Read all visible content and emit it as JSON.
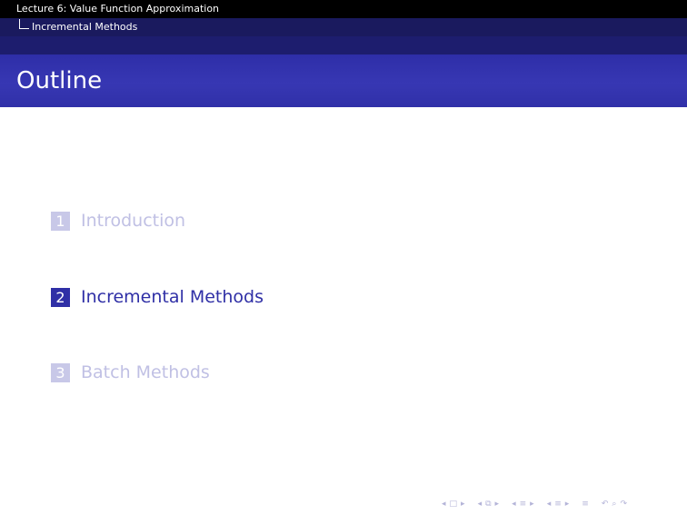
{
  "header": {
    "lecture_title": "Lecture 6: Value Function Approximation",
    "section_title": "Incremental Methods"
  },
  "frame": {
    "title": "Outline"
  },
  "toc": {
    "items": [
      {
        "number": "1",
        "label": "Introduction",
        "state": "faded"
      },
      {
        "number": "2",
        "label": "Incremental Methods",
        "state": "active"
      },
      {
        "number": "3",
        "label": "Batch Methods",
        "state": "faded"
      }
    ]
  },
  "navigation": {
    "icons": [
      "prev-arrow",
      "frame-icon",
      "next-arrow",
      "prev-arrow",
      "subsection-icon",
      "next-arrow",
      "prev-arrow",
      "section-icon",
      "next-arrow",
      "prev-arrow",
      "section-icon",
      "next-arrow",
      "align-icon",
      "back-icon",
      "search-icon",
      "forward-icon"
    ]
  },
  "colors": {
    "accent": "#2f2fa6",
    "faded": "#c0c0e4",
    "header_dark": "#000000",
    "header_mid": "#1a1a5e"
  }
}
